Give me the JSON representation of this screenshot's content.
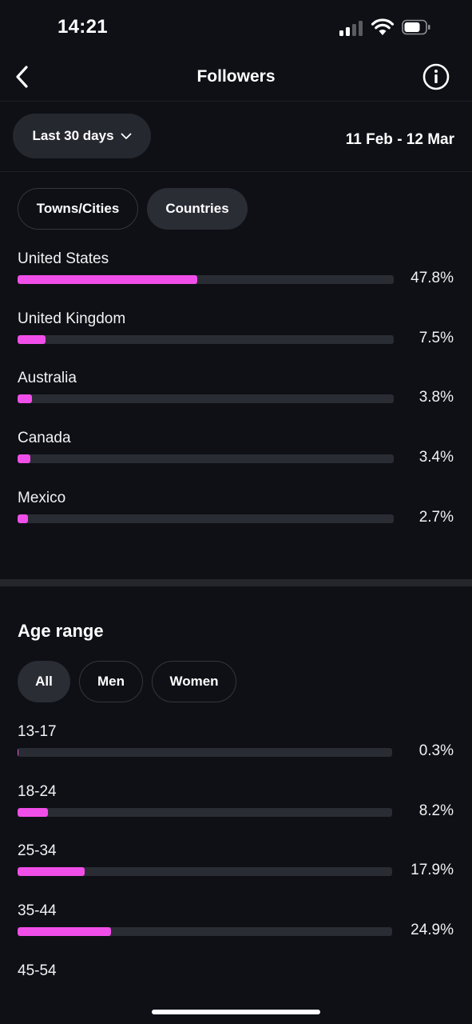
{
  "status_bar": {
    "time": "14:21"
  },
  "header": {
    "title": "Followers"
  },
  "filter": {
    "range_label": "Last 30 days",
    "date_range": "11 Feb - 12 Mar"
  },
  "location": {
    "tabs": [
      {
        "label": "Towns/Cities",
        "selected": false
      },
      {
        "label": "Countries",
        "selected": true
      }
    ],
    "items": [
      {
        "label": "United States",
        "value": "47.8%",
        "percent": 47.8
      },
      {
        "label": "United Kingdom",
        "value": "7.5%",
        "percent": 7.5
      },
      {
        "label": "Australia",
        "value": "3.8%",
        "percent": 3.8
      },
      {
        "label": "Canada",
        "value": "3.4%",
        "percent": 3.4
      },
      {
        "label": "Mexico",
        "value": "2.7%",
        "percent": 2.7
      }
    ]
  },
  "age": {
    "title": "Age range",
    "tabs": [
      {
        "label": "All",
        "selected": true
      },
      {
        "label": "Men",
        "selected": false
      },
      {
        "label": "Women",
        "selected": false
      }
    ],
    "items": [
      {
        "label": "13-17",
        "value": "0.3%",
        "percent": 0.3
      },
      {
        "label": "18-24",
        "value": "8.2%",
        "percent": 8.2
      },
      {
        "label": "25-34",
        "value": "17.9%",
        "percent": 17.9
      },
      {
        "label": "35-44",
        "value": "24.9%",
        "percent": 24.9
      },
      {
        "label": "45-54"
      }
    ]
  },
  "colors": {
    "background": "#0e1016",
    "accent": "#f04ee8",
    "track": "#2a2c33",
    "chip": "#2b2d35"
  }
}
